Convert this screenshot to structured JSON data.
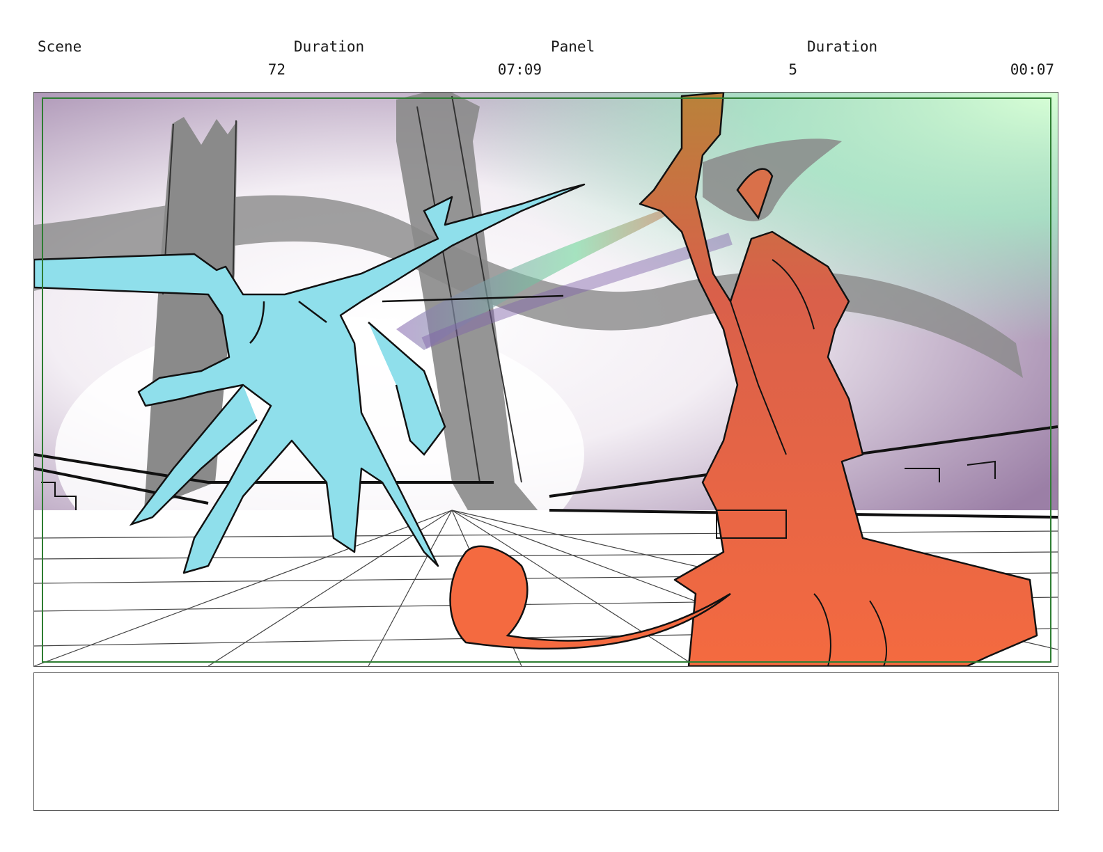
{
  "header": {
    "scene_label": "Scene",
    "scene_duration_label": "Duration",
    "panel_label": "Panel",
    "panel_duration_label": "Duration",
    "scene_value": "72",
    "scene_duration_value": "07:09",
    "panel_value": "5",
    "panel_duration_value": "00:07"
  },
  "notes": {
    "text": ""
  },
  "colors": {
    "cyan_figure": "#8fdfeb",
    "orange_figure": "#f26a45",
    "safe_area": "#2e7d32",
    "sky_purple": "#9b7fa6",
    "sky_green": "#a8f0c8",
    "architecture": "#8a8a8a"
  }
}
